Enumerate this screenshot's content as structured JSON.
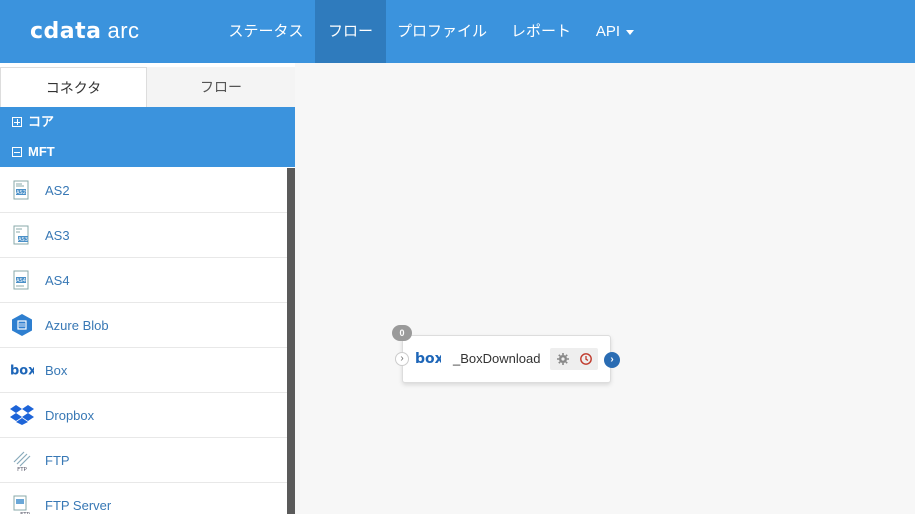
{
  "app": {
    "logo_main": "cdata",
    "logo_sub": "arc"
  },
  "nav": {
    "items": [
      {
        "label": "ステータス",
        "active": false
      },
      {
        "label": "フロー",
        "active": true
      },
      {
        "label": "プロファイル",
        "active": false
      },
      {
        "label": "レポート",
        "active": false
      },
      {
        "label": "API",
        "active": false,
        "dropdown": true
      }
    ]
  },
  "sidebar": {
    "tabs": [
      {
        "label": "コネクタ",
        "active": true
      },
      {
        "label": "フロー",
        "active": false
      }
    ],
    "categories": [
      {
        "label": "コア",
        "expanded": false
      },
      {
        "label": "MFT",
        "expanded": true
      }
    ],
    "connectors": [
      {
        "label": "AS2",
        "icon": "as2-icon"
      },
      {
        "label": "AS3",
        "icon": "as3-icon"
      },
      {
        "label": "AS4",
        "icon": "as4-icon"
      },
      {
        "label": "Azure Blob",
        "icon": "azure-blob-icon"
      },
      {
        "label": "Box",
        "icon": "box-icon"
      },
      {
        "label": "Dropbox",
        "icon": "dropbox-icon"
      },
      {
        "label": "FTP",
        "icon": "ftp-icon"
      },
      {
        "label": "FTP Server",
        "icon": "ftp-server-icon"
      }
    ],
    "collapse_glyph": "‹"
  },
  "canvas": {
    "node": {
      "title": "_BoxDownload",
      "badge": "0",
      "logo": "box",
      "in_glyph": "›",
      "out_glyph": "›"
    }
  },
  "colors": {
    "header": "#3b93dd",
    "header_active": "#2f7bbd",
    "link": "#3878b5",
    "node_out": "#2a6cb3"
  }
}
